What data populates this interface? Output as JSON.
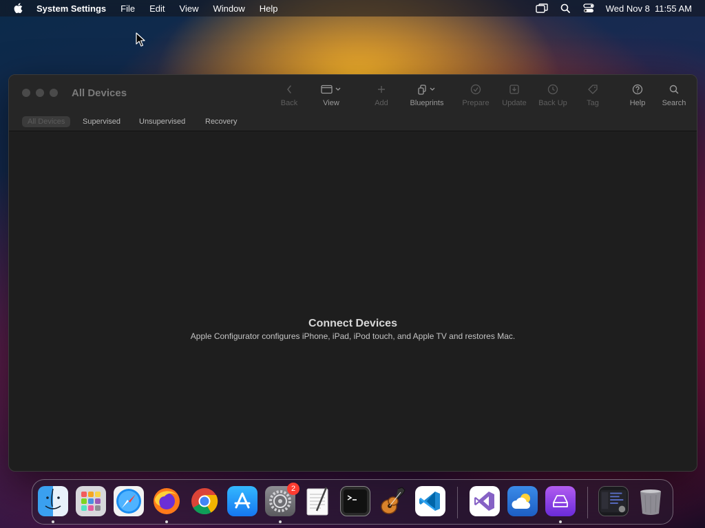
{
  "menubar": {
    "app_name": "System Settings",
    "items": [
      "File",
      "Edit",
      "View",
      "Window",
      "Help"
    ],
    "clock": "Wed Nov 8  11:55 AM"
  },
  "window": {
    "title": "All Devices",
    "toolbar": [
      {
        "label": "Back",
        "icon": "chevron-left-icon",
        "enabled": false
      },
      {
        "label": "View",
        "icon": "view-icon",
        "enabled": true
      },
      {
        "label": "Add",
        "icon": "plus-icon",
        "enabled": false
      },
      {
        "label": "Blueprints",
        "icon": "blueprints-icon",
        "enabled": true
      },
      {
        "label": "Prepare",
        "icon": "prepare-icon",
        "enabled": false
      },
      {
        "label": "Update",
        "icon": "update-icon",
        "enabled": false
      },
      {
        "label": "Back Up",
        "icon": "backup-icon",
        "enabled": false
      },
      {
        "label": "Tag",
        "icon": "tag-icon",
        "enabled": false
      },
      {
        "label": "Help",
        "icon": "help-icon",
        "enabled": true
      },
      {
        "label": "Search",
        "icon": "search-icon",
        "enabled": true
      }
    ],
    "tabs": [
      "All Devices",
      "Supervised",
      "Unsupervised",
      "Recovery"
    ],
    "active_tab": "All Devices",
    "empty_state": {
      "title": "Connect Devices",
      "subtitle": "Apple Configurator configures iPhone, iPad, iPod touch, and Apple TV and restores Mac."
    }
  },
  "dock": {
    "apps": [
      {
        "name": "Finder",
        "icon": "finder-icon",
        "running": true
      },
      {
        "name": "Launchpad",
        "icon": "launchpad-icon",
        "running": false
      },
      {
        "name": "Safari",
        "icon": "safari-icon",
        "running": false
      },
      {
        "name": "Firefox",
        "icon": "firefox-icon",
        "running": true
      },
      {
        "name": "Chrome",
        "icon": "chrome-icon",
        "running": false
      },
      {
        "name": "App Store",
        "icon": "app-store-icon",
        "running": false
      },
      {
        "name": "System Settings",
        "icon": "system-settings-icon",
        "running": true,
        "badge": "2"
      },
      {
        "name": "TextEdit",
        "icon": "textedit-icon",
        "running": false
      },
      {
        "name": "Terminal",
        "icon": "terminal-icon",
        "running": false
      },
      {
        "name": "GarageBand",
        "icon": "garageband-icon",
        "running": false
      },
      {
        "name": "VS Code",
        "icon": "vscode-icon",
        "running": false
      },
      {
        "name": "Visual Studio",
        "icon": "visual-studio-icon",
        "running": false
      },
      {
        "name": "Weather",
        "icon": "weather-icon",
        "running": false
      },
      {
        "name": "Apple Configurator",
        "icon": "apple-configurator-icon",
        "running": true
      },
      {
        "name": "Downloads",
        "icon": "downloads-stack-icon",
        "running": false
      },
      {
        "name": "Trash",
        "icon": "trash-icon",
        "running": false
      }
    ],
    "badge": "2"
  }
}
